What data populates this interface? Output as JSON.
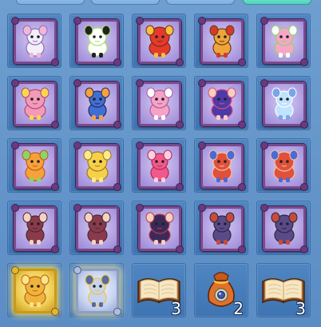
{
  "tabs": [
    {
      "state": "normal"
    },
    {
      "state": "normal"
    },
    {
      "state": "normal"
    },
    {
      "state": "active"
    }
  ],
  "rows": [
    [
      {
        "kind": "pet-card",
        "frame": "purple",
        "icon": "white-mouse-pet-icon",
        "colors": [
          "#f4eef8",
          "#f2b7d6",
          "#8c6fb8"
        ]
      },
      {
        "kind": "pet-card",
        "frame": "purple",
        "icon": "panda-pet-icon",
        "colors": [
          "#ffffff",
          "#222222",
          "#a6e36a"
        ]
      },
      {
        "kind": "pet-card",
        "frame": "purple",
        "icon": "red-dragon-pet-icon",
        "colors": [
          "#e53a2b",
          "#f5c23a",
          "#7b2a1c"
        ]
      },
      {
        "kind": "pet-card",
        "frame": "purple",
        "icon": "lion-drummer-pet-icon",
        "colors": [
          "#f0a53a",
          "#d33a2a",
          "#6b3a1a"
        ]
      },
      {
        "kind": "pet-card",
        "frame": "purple",
        "icon": "pink-bird-pet-icon",
        "colors": [
          "#f7a6c8",
          "#ffffff",
          "#8bd36a"
        ]
      }
    ],
    [
      {
        "kind": "pet-card",
        "frame": "purple",
        "icon": "pink-flower-pet-icon",
        "colors": [
          "#f29ab8",
          "#f7d84a",
          "#b04a7a"
        ]
      },
      {
        "kind": "pet-card",
        "frame": "purple",
        "icon": "blue-monkey-pet-icon",
        "colors": [
          "#3f6fd6",
          "#f3a33a",
          "#2a2a5a"
        ]
      },
      {
        "kind": "pet-card",
        "frame": "purple",
        "icon": "pink-dragon-pet-icon",
        "colors": [
          "#f4a2c6",
          "#ffffff",
          "#b05a9a"
        ]
      },
      {
        "kind": "pet-card",
        "frame": "purple",
        "icon": "purple-girl-pet-icon",
        "colors": [
          "#4b3aa8",
          "#f3d2c0",
          "#e24a7a"
        ]
      },
      {
        "kind": "pet-card",
        "frame": "purple",
        "icon": "ice-dragon-pet-icon",
        "colors": [
          "#bfe2ff",
          "#7aa6e8",
          "#ffffff"
        ]
      }
    ],
    [
      {
        "kind": "pet-card",
        "frame": "purple",
        "icon": "orange-chick-pet-icon",
        "colors": [
          "#f6a23a",
          "#8bd36a",
          "#c45a1a"
        ]
      },
      {
        "kind": "pet-card",
        "frame": "purple",
        "icon": "yellow-pear-pet-icon",
        "colors": [
          "#f7d04a",
          "#ffe98a",
          "#9a7a1a"
        ]
      },
      {
        "kind": "pet-card",
        "frame": "purple",
        "icon": "pink-fairy-pet-icon",
        "colors": [
          "#f05a8a",
          "#ffd0e0",
          "#b02a5a"
        ]
      },
      {
        "kind": "pet-card",
        "frame": "purple",
        "icon": "red-warrior-pet-icon",
        "colors": [
          "#e0503a",
          "#4a6ad8",
          "#f3c2a0"
        ]
      },
      {
        "kind": "pet-card",
        "frame": "purple",
        "icon": "red-warrior-pet-icon",
        "colors": [
          "#e0503a",
          "#4a6ad8",
          "#f3c2a0"
        ]
      }
    ],
    [
      {
        "kind": "pet-card",
        "frame": "purple",
        "icon": "bat-pet-icon",
        "colors": [
          "#8a3a4a",
          "#f3d2c0",
          "#4a2a3a"
        ]
      },
      {
        "kind": "pet-card",
        "frame": "purple",
        "icon": "bat-pet-icon",
        "colors": [
          "#8a3a4a",
          "#f3d2c0",
          "#4a2a3a"
        ]
      },
      {
        "kind": "pet-card",
        "frame": "purple",
        "icon": "dark-mage-pet-icon",
        "colors": [
          "#3a2a5a",
          "#f3d2c0",
          "#c23a4a"
        ]
      },
      {
        "kind": "pet-card",
        "frame": "purple",
        "icon": "armored-beast-pet-icon",
        "colors": [
          "#5a4a8a",
          "#c84a3a",
          "#2a2a3a"
        ]
      },
      {
        "kind": "pet-card",
        "frame": "purple",
        "icon": "armored-beast-pet-icon",
        "colors": [
          "#5a4a8a",
          "#c84a3a",
          "#2a2a3a"
        ]
      }
    ],
    [
      {
        "kind": "pet-card",
        "frame": "gold",
        "icon": "golden-dragon-pet-icon",
        "colors": [
          "#f0b43a",
          "#ffe28a",
          "#b06a1a"
        ]
      },
      {
        "kind": "pet-card",
        "frame": "silver",
        "icon": "armored-knight-pet-icon",
        "colors": [
          "#c8d4ee",
          "#5a6a9a",
          "#f0c23a"
        ]
      },
      {
        "kind": "item",
        "icon": "open-book-icon",
        "count": "3"
      },
      {
        "kind": "item",
        "icon": "orange-pouch-icon",
        "count": "2"
      },
      {
        "kind": "item",
        "icon": "open-book-icon",
        "count": "3"
      }
    ]
  ]
}
